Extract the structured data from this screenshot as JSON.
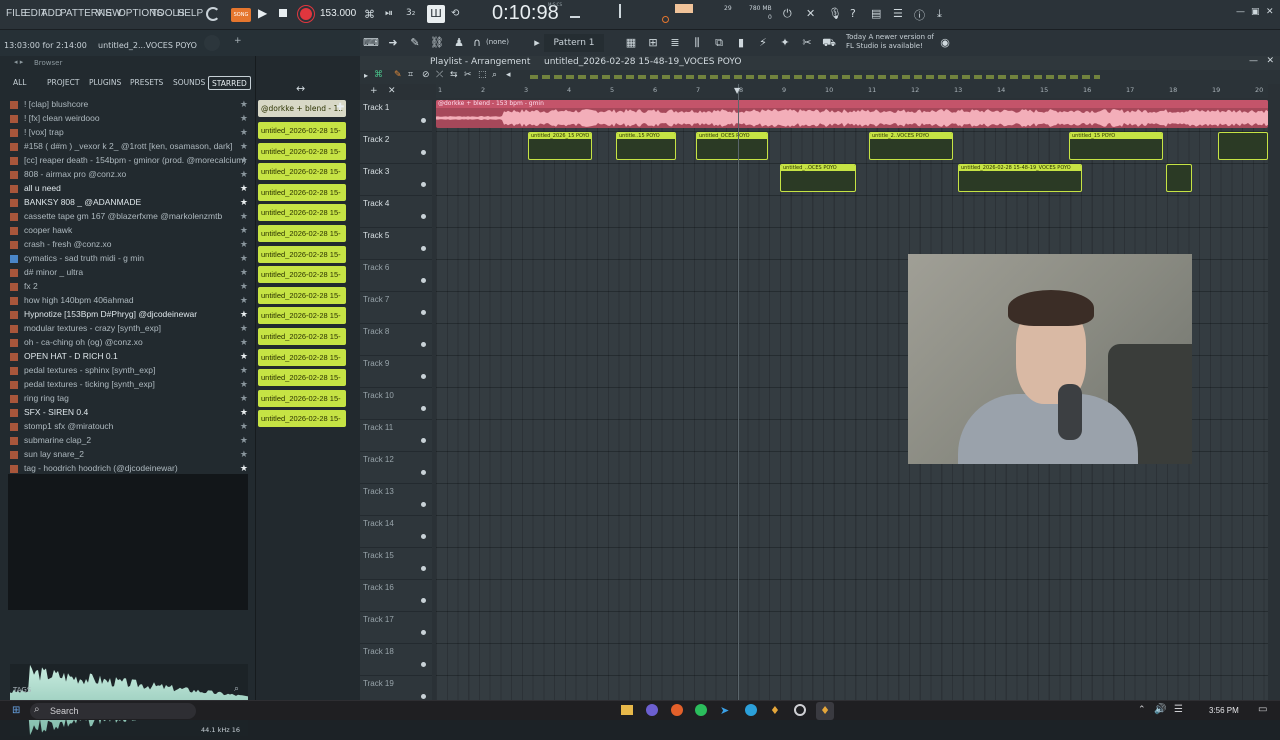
{
  "menu": [
    "FILE",
    "EDIT",
    "ADD",
    "PATTERNS",
    "VIEW",
    "OPTIONS",
    "TOOLS",
    "HELP"
  ],
  "transport": {
    "tempo": "153.000",
    "time": "0:10:98",
    "time_sub": "M:S:CS",
    "cpu_small": "29",
    "ram": "780 MB",
    "ram_sub": "0"
  },
  "hint": {
    "time": "13:03:00 for 2:14:00",
    "project": "untitled_2...VOCES POYO"
  },
  "toolbar2": {
    "snap": "(none)",
    "pattern": "Pattern 1",
    "news_line1": "Today  A newer version of",
    "news_line2": "FL Studio is available!"
  },
  "browser": {
    "title": "Browser",
    "tabs": [
      "ALL",
      "PROJECT",
      "PLUGINS",
      "PRESETS",
      "SOUNDS",
      "STARRED"
    ],
    "items": [
      "! [clap] blushcore",
      "! [fx] clean weirdooo",
      "! [vox] trap",
      "#158 ( d#m ) _vexor k 2_ @1rott [ken, osamason, dark]",
      "[cc] reaper death - 154bpm - gminor (prod. @morecalcium)",
      "808 - airmax pro @conz.xo",
      "all u need",
      "BANKSY 808 _ @ADANMADE",
      "cassette tape gm 167 @blazerfxme @markolenzmtb",
      "cooper hawk",
      "crash - fresh @conz.xo",
      "cymatics - sad truth midi - g min",
      "d# minor _ ultra",
      "fx 2",
      "how high 140bpm 406ahmad",
      "Hypnotize [153Bpm D#Phryg] @djcodeinewar",
      "modular textures - crazy [synth_exp]",
      "oh - ca-ching oh (og) @conz.xo",
      "OPEN HAT - D RICH 0.1",
      "pedal textures - sphinx [synth_exp]",
      "pedal textures - ticking [synth_exp]",
      "ring ring tag",
      "SFX - SIREN 0.4",
      "stomp1 sfx @miratouch",
      "submarine clap_2",
      "sun lay snare_2",
      "tag - hoodrich hoodrich (@djcodeinewar)"
    ],
    "sample_info": "44.1 kHz 16",
    "tags_label": "TAGS"
  },
  "patterns": {
    "first": "@dorkke + blend - 1..",
    "items": [
      "untitled_2026-02-28 15-",
      "untitled_2026-02-28 15-",
      "untitled_2026-02-28 15-",
      "untitled_2026-02-28 15-",
      "untitled_2026-02-28 15-",
      "untitled_2026-02-28 15-",
      "untitled_2026-02-28 15-",
      "untitled_2026-02-28 15-",
      "untitled_2026-02-28 15-",
      "untitled_2026-02-28 15-",
      "untitled_2026-02-28 15-",
      "untitled_2026-02-28 15-",
      "untitled_2026-02-28 15-",
      "untitled_2026-02-28 15-",
      "untitled_2026-02-28 15-"
    ]
  },
  "playlist": {
    "title": "Playlist - Arrangement",
    "project": "untitled_2026-02-28 15-48-19_VOCES POYO",
    "ruler": [
      "1",
      "2",
      "3",
      "4",
      "5",
      "6",
      "7",
      "8",
      "9",
      "10",
      "11",
      "12",
      "13",
      "14",
      "15",
      "16",
      "17",
      "18",
      "19",
      "20"
    ],
    "tracks": [
      "Track 1",
      "Track 2",
      "Track 3",
      "Track 4",
      "Track 5",
      "Track 6",
      "Track 7",
      "Track 8",
      "Track 9",
      "Track 10",
      "Track 11",
      "Track 12",
      "Track 13",
      "Track 14",
      "Track 15",
      "Track 16",
      "Track 17",
      "Track 18",
      "Track 19"
    ],
    "clip_main": "@dorkke + blend - 153 bpm - gmin",
    "clip_t2a": "untitled_2026_15 POYO",
    "clip_t2b": "untitle..15 POYO",
    "clip_t2c": "untitled_OCES POYO",
    "clip_t2d": "untitle_2..VOCES POYO",
    "clip_t2e": "untitled_15 POYO",
    "clip_t3a": "untitled_..OCES POYO",
    "clip_t3b": "untitled_2026-02-28 15-48-19_VOCES POYO"
  },
  "taskbar": {
    "search": "Search",
    "clock": "3:56 PM"
  },
  "colors": {
    "pattern_green": "#c6e344",
    "audio_red": "#c4546a",
    "accent_record": "#e0363e"
  }
}
